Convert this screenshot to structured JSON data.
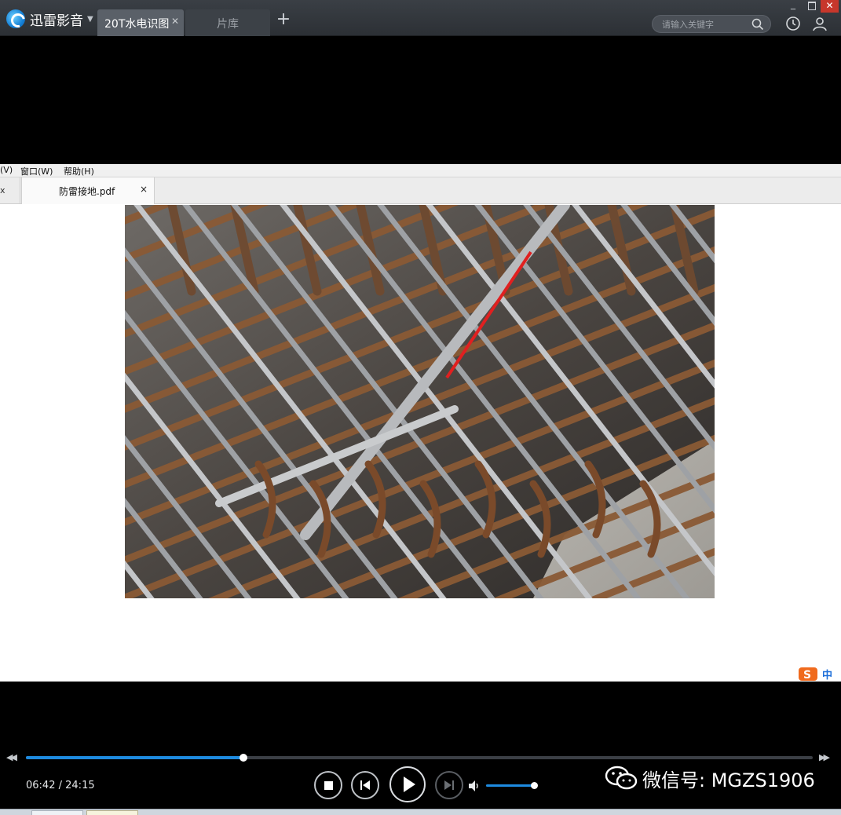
{
  "app": {
    "name": "迅雷影音"
  },
  "tabs": [
    {
      "label": "20T水电识图",
      "active": true
    },
    {
      "label": "片库",
      "active": false
    }
  ],
  "search": {
    "placeholder": "请输入关键字"
  },
  "window_controls": {
    "minimize": "_",
    "close": "✕"
  },
  "icons": {
    "brand": "xunlei-logo-icon",
    "caret": "chevron-down-icon",
    "tab_close": "close-icon",
    "tab_add": "plus-icon",
    "search": "search-icon",
    "history": "clock-icon",
    "user": "user-icon",
    "stop": "stop-icon",
    "prev": "skip-previous-icon",
    "play": "play-icon",
    "next": "skip-next-icon",
    "volume": "volume-icon",
    "wechat": "wechat-icon"
  },
  "video_content": {
    "pdf_menu": [
      "(V)",
      "窗口(W)",
      "帮助(H)"
    ],
    "pdf_tab_prev": "x",
    "pdf_tab_label": "防雷接地.pdf",
    "pdf_tab_close": "×",
    "ime_label": "中",
    "photo_subject": "rebar-cage-with-grounding-weld-line"
  },
  "player": {
    "time_current": "06:42",
    "time_separator": "/",
    "time_total": "24:15",
    "progress_fraction": 0.2763,
    "volume_fraction": 0.98
  },
  "watermark": {
    "text": "微信号: MGZS1906"
  },
  "colors": {
    "accent": "#1e8be0",
    "close_red": "#c7372b",
    "titlebar": "#33383e",
    "annotation_line": "#e02020"
  }
}
